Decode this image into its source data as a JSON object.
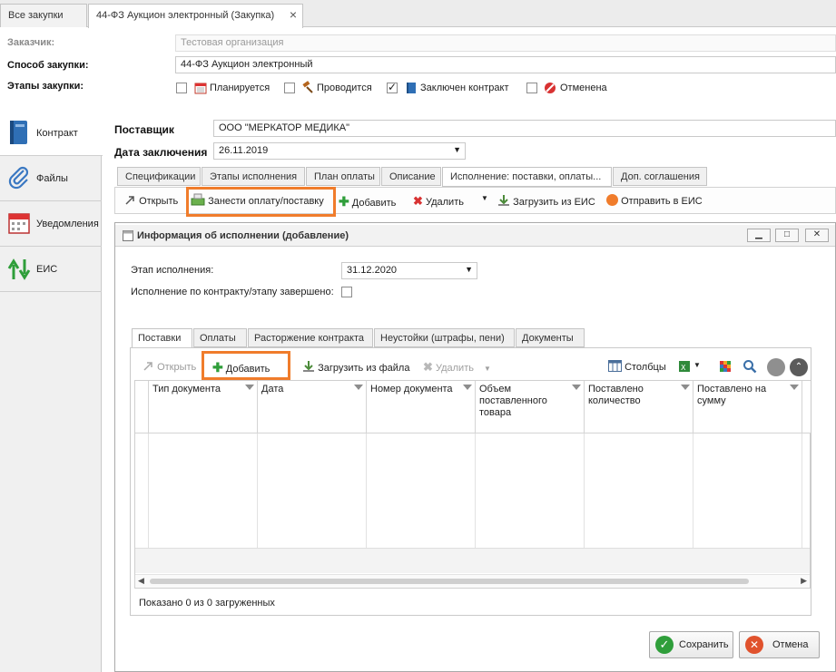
{
  "doc_tabs": [
    {
      "label": "Все закупки"
    },
    {
      "label": "44-ФЗ Аукцион электронный (Закупка)"
    }
  ],
  "header": {
    "customer_label": "Заказчик:",
    "customer_value": "Тестовая организация",
    "method_label": "Способ закупки:",
    "method_value": "44-ФЗ Аукцион электронный",
    "stages_label": "Этапы закупки:",
    "stages": [
      {
        "label": "Планируется",
        "checked": false
      },
      {
        "label": "Проводится",
        "checked": false
      },
      {
        "label": "Заключен контракт",
        "checked": true
      },
      {
        "label": "Отменена",
        "checked": false
      }
    ]
  },
  "left_nav": {
    "items": [
      {
        "label": "Контракт",
        "icon": "book-icon"
      },
      {
        "label": "Файлы",
        "icon": "paperclip-icon"
      },
      {
        "label": "Уведомления",
        "icon": "calendar-icon"
      },
      {
        "label": "ЕИС",
        "icon": "up-down-arrows-icon"
      }
    ]
  },
  "contract": {
    "supplier_label": "Поставщик",
    "supplier_value": "ООО \"МЕРКАТОР МЕДИКА\"",
    "date_label": "Дата заключения",
    "date_value": "26.11.2019"
  },
  "content_tabs": [
    {
      "label": "Спецификации"
    },
    {
      "label": "Этапы исполнения"
    },
    {
      "label": "План оплаты"
    },
    {
      "label": "Описание"
    },
    {
      "label": "Исполнение: поставки, оплаты..."
    },
    {
      "label": "Доп. соглашения"
    }
  ],
  "toolbar": {
    "open": "Открыть",
    "enter_payment": "Занести оплату/поставку",
    "add": "Добавить",
    "delete": "Удалить",
    "load_eis": "Загрузить из ЕИС",
    "send_eis": "Отправить в ЕИС"
  },
  "dialog": {
    "title": "Информация об исполнении (добавление)",
    "stage_label": "Этап исполнения:",
    "stage_value": "31.12.2020",
    "completed_label": "Исполнение по контракту/этапу завершено:",
    "tabs": [
      {
        "label": "Поставки"
      },
      {
        "label": "Оплаты"
      },
      {
        "label": "Расторжение контракта"
      },
      {
        "label": "Неустойки (штрафы, пени)"
      },
      {
        "label": "Документы"
      }
    ],
    "toolbar": {
      "open": "Открыть",
      "add": "Добавить",
      "load_file": "Загрузить из файла",
      "delete": "Удалить",
      "columns": "Столбцы"
    },
    "grid": {
      "columns": [
        "Тип документа",
        "Дата",
        "Номер документа",
        "Объем поставленного товара",
        "Поставлено количество",
        "Поставлено на сумму"
      ]
    },
    "status": "Показано 0 из 0 загруженных",
    "save": "Сохранить",
    "cancel": "Отмена"
  },
  "colors": {
    "highlight": "#f07c2b",
    "green": "#2f9e3a",
    "red": "#d83232"
  }
}
